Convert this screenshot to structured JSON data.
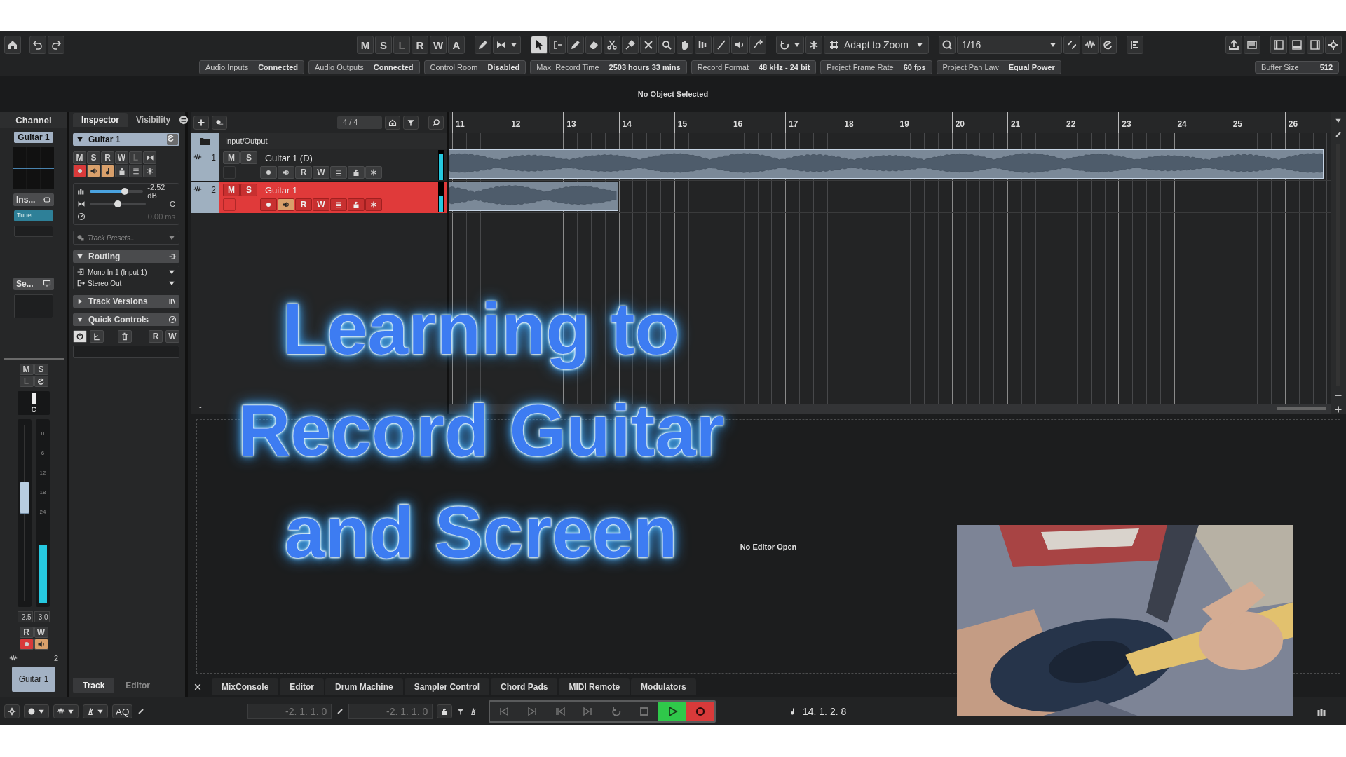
{
  "toolbar": {
    "mode_buttons": [
      {
        "label": "M",
        "disabled": false
      },
      {
        "label": "S",
        "disabled": false
      },
      {
        "label": "L",
        "disabled": true
      },
      {
        "label": "R",
        "disabled": false
      },
      {
        "label": "W",
        "disabled": false
      },
      {
        "label": "A",
        "disabled": false
      }
    ],
    "tools": [
      {
        "kind": "pointer",
        "selected": true
      },
      {
        "kind": "range",
        "selected": false
      },
      {
        "kind": "pencil",
        "selected": false
      },
      {
        "kind": "eraser",
        "selected": false
      },
      {
        "kind": "scissors",
        "selected": false
      },
      {
        "kind": "glue",
        "selected": false
      },
      {
        "kind": "mute",
        "selected": false
      },
      {
        "kind": "zoom",
        "selected": false
      },
      {
        "kind": "hand",
        "selected": false
      },
      {
        "kind": "comp",
        "selected": false
      },
      {
        "kind": "line",
        "selected": false
      },
      {
        "kind": "speaker",
        "selected": false
      },
      {
        "kind": "warp",
        "selected": false
      }
    ],
    "snap_type": "Adapt to Zoom",
    "quantize": "1/16"
  },
  "status_bar": [
    {
      "label": "Audio Inputs",
      "value": "Connected"
    },
    {
      "label": "Audio Outputs",
      "value": "Connected"
    },
    {
      "label": "Control Room",
      "value": "Disabled"
    },
    {
      "label": "Max. Record Time",
      "value": "2503 hours 33 mins"
    },
    {
      "label": "Record Format",
      "value": "48 kHz - 24 bit"
    },
    {
      "label": "Project Frame Rate",
      "value": "60 fps"
    },
    {
      "label": "Project Pan Law",
      "value": "Equal Power"
    }
  ],
  "buffer": {
    "label": "Buffer Size",
    "value": "512"
  },
  "info_line": "No Object Selected",
  "channel_strip": {
    "tab": "Channel",
    "track_name": "Guitar 1",
    "inserts": "Ins...",
    "insert_slots": [
      "Tuner"
    ],
    "sends": "Se...",
    "buttons": [
      {
        "label": "M",
        "disabled": false
      },
      {
        "label": "S",
        "disabled": false
      },
      {
        "label": "L",
        "disabled": true
      }
    ],
    "pan": "C",
    "fader": {
      "level": 0.6
    },
    "meter": {
      "level": 0.33
    },
    "scale": [
      "0",
      "6",
      "12",
      "18",
      "24"
    ],
    "peaks": [
      "-2.5",
      "-3.0"
    ],
    "rw": [
      "R",
      "W"
    ],
    "record_enabled": true,
    "monitor": true,
    "number": "2",
    "name": "Guitar 1"
  },
  "inspector": {
    "tabs": [
      {
        "label": "Inspector",
        "selected": true
      },
      {
        "label": "Visibility",
        "selected": false
      }
    ],
    "track_name": "Guitar 1",
    "expanded": true,
    "buttons": [
      {
        "label": "M",
        "disabled": false
      },
      {
        "label": "S",
        "disabled": false
      },
      {
        "label": "R",
        "disabled": false
      },
      {
        "label": "W",
        "disabled": false
      },
      {
        "label": "L",
        "disabled": true
      }
    ],
    "record_enabled": true,
    "monitor": true,
    "musical_mode": true,
    "volume": {
      "level": 0.66,
      "reading": "-2.52 dB"
    },
    "pan": {
      "level": 0.5,
      "reading": "C"
    },
    "delay": "0.00 ms",
    "presets_placeholder": "Track Presets...",
    "sections": [
      {
        "kind": "routing",
        "title": "Routing",
        "expanded": true
      },
      {
        "kind": "versions",
        "title": "Track Versions",
        "expanded": false
      },
      {
        "kind": "quick_controls",
        "title": "Quick Controls",
        "expanded": true
      }
    ],
    "routing": [
      "Mono In 1 (Input 1)",
      "Stereo Out"
    ],
    "quick_controls_rw": [
      "R",
      "W"
    ],
    "bottom_tabs": [
      {
        "label": "Track",
        "selected": true
      },
      {
        "label": "Editor",
        "selected": false
      }
    ]
  },
  "project": {
    "signature": "4 / 4",
    "folder": "Input/Output",
    "tracks": [
      {
        "number": "1",
        "name": "Guitar 1 (D)",
        "selected": false,
        "monitor": false,
        "buttons": [
          "M",
          "S",
          "R",
          "W"
        ],
        "meter": {
          "level": 0.85
        }
      },
      {
        "number": "2",
        "name": "Guitar 1",
        "selected": true,
        "monitor": true,
        "buttons": [
          "M",
          "S",
          "R",
          "W"
        ],
        "meter": {
          "level": 0.55
        }
      }
    ],
    "ruler": [
      "11",
      "12",
      "13",
      "14",
      "15",
      "16",
      "17",
      "18",
      "19",
      "20",
      "21",
      "22",
      "23",
      "24",
      "25",
      "26"
    ],
    "corner_mark": "-"
  },
  "editor": {
    "message": "No Editor Open"
  },
  "lower_zone_tabs": [
    "MixConsole",
    "Editor",
    "Drum Machine",
    "Sampler Control",
    "Chord Pads",
    "MIDI Remote",
    "Modulators"
  ],
  "transport": {
    "aq": "AQ",
    "left_locator": "-2. 1. 1. 0",
    "right_locator": "-2. 1. 1. 0",
    "buttons": [
      {
        "kind": "start",
        "on": false
      },
      {
        "kind": "end",
        "on": false
      },
      {
        "kind": "rewind",
        "on": false
      },
      {
        "kind": "forward",
        "on": false
      },
      {
        "kind": "cycle",
        "on": false
      },
      {
        "kind": "stop",
        "on": false
      },
      {
        "kind": "play",
        "on": true
      },
      {
        "kind": "record",
        "on": true
      }
    ],
    "position": "14. 1. 2. 8"
  },
  "title_overlay": [
    "Learning to",
    "Record Guitar",
    "and Screen"
  ]
}
